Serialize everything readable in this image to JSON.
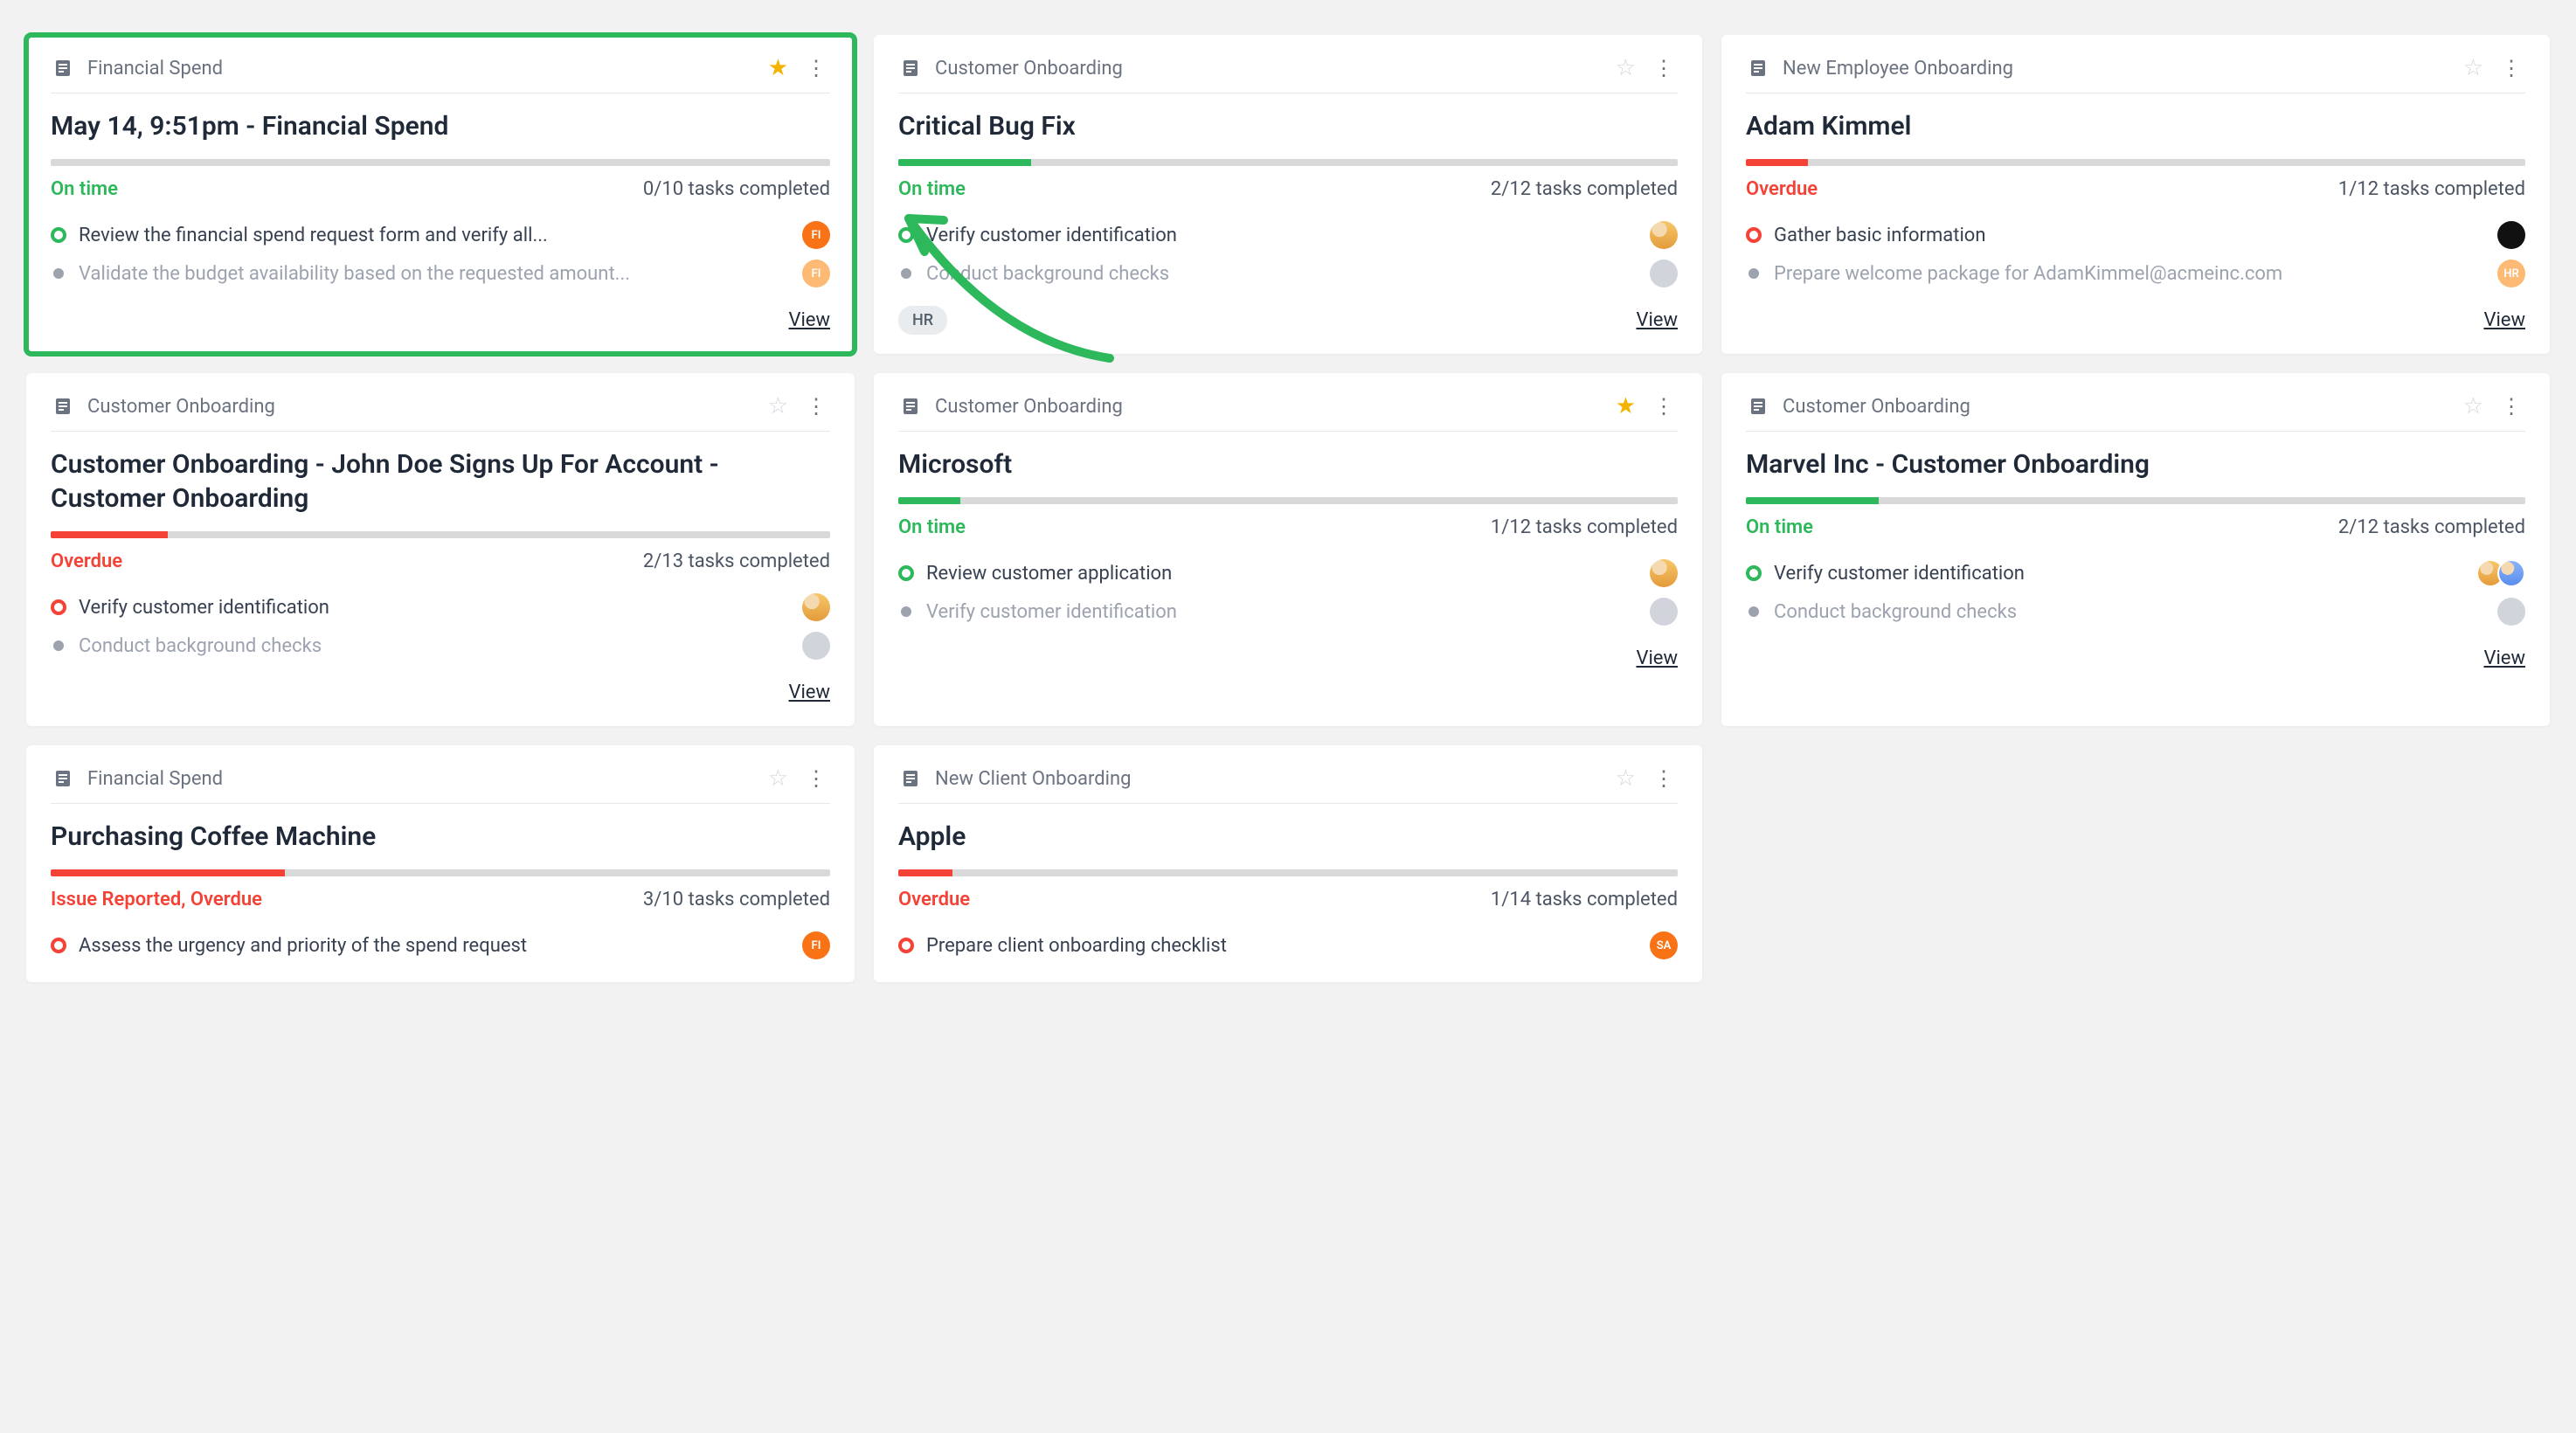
{
  "labels": {
    "view": "View"
  },
  "cards": [
    {
      "category": "Financial Spend",
      "starred": true,
      "title": "May 14, 9:51pm - Financial Spend",
      "progress_pct": 0,
      "progress_color": "green",
      "status_text": "On time",
      "status_color": "green",
      "tasks_text": "0/10 tasks completed",
      "tasks": [
        {
          "text": "Review the financial spend request form and verify all...",
          "state": "active",
          "avatar": {
            "type": "text",
            "label": "FI",
            "cls": "orange"
          }
        },
        {
          "text": "Validate the budget availability based on the requested amount...",
          "state": "pending",
          "muted": true,
          "avatar": {
            "type": "text",
            "label": "FI",
            "cls": "orange-muted"
          }
        }
      ],
      "tags": [],
      "highlight": true
    },
    {
      "category": "Customer Onboarding",
      "starred": false,
      "title": "Critical Bug Fix",
      "progress_pct": 17,
      "progress_color": "green",
      "status_text": "On time",
      "status_color": "green",
      "tasks_text": "2/12 tasks completed",
      "tasks": [
        {
          "text": "Verify customer identification",
          "state": "active",
          "avatar": {
            "type": "img",
            "cls": "img"
          }
        },
        {
          "text": "Conduct background checks",
          "state": "pending",
          "muted": true,
          "avatar": {
            "type": "img",
            "cls": "gray"
          }
        }
      ],
      "tags": [
        "HR"
      ]
    },
    {
      "category": "New Employee Onboarding",
      "starred": false,
      "title": "Adam Kimmel",
      "progress_pct": 8,
      "progress_color": "red",
      "status_text": "Overdue",
      "status_color": "red",
      "tasks_text": "1/12 tasks completed",
      "tasks": [
        {
          "text": "Gather basic information",
          "state": "active-red",
          "avatar": {
            "type": "img",
            "cls": "black"
          }
        },
        {
          "text": "Prepare welcome package for AdamKimmel@acmeinc.com",
          "state": "pending",
          "muted": true,
          "avatar": {
            "type": "text",
            "label": "HR",
            "cls": "orange-muted"
          }
        }
      ],
      "tags": []
    },
    {
      "category": "Customer Onboarding",
      "starred": false,
      "title": "Customer Onboarding - John Doe Signs Up For Account - Customer Onboarding",
      "progress_pct": 15,
      "progress_color": "red",
      "status_text": "Overdue",
      "status_color": "red",
      "tasks_text": "2/13 tasks completed",
      "tasks": [
        {
          "text": "Verify customer identification",
          "state": "active-red",
          "avatar": {
            "type": "img",
            "cls": "img"
          }
        },
        {
          "text": "Conduct background checks",
          "state": "pending",
          "muted": true,
          "avatar": {
            "type": "img",
            "cls": "gray"
          }
        }
      ],
      "tags": []
    },
    {
      "category": "Customer Onboarding",
      "starred": true,
      "title": "Microsoft",
      "progress_pct": 8,
      "progress_color": "green",
      "status_text": "On time",
      "status_color": "green",
      "tasks_text": "1/12 tasks completed",
      "tasks": [
        {
          "text": "Review customer application",
          "state": "active",
          "avatar": {
            "type": "img",
            "cls": "img"
          }
        },
        {
          "text": "Verify customer identification",
          "state": "pending",
          "muted": true,
          "avatar": {
            "type": "img",
            "cls": "gray"
          }
        }
      ],
      "tags": []
    },
    {
      "category": "Customer Onboarding",
      "starred": false,
      "title": "Marvel Inc - Customer Onboarding",
      "progress_pct": 17,
      "progress_color": "green",
      "status_text": "On time",
      "status_color": "green",
      "tasks_text": "2/12 tasks completed",
      "tasks": [
        {
          "text": "Verify customer identification",
          "state": "active",
          "avatar_stack": [
            {
              "cls": "img"
            },
            {
              "cls": "img2"
            }
          ]
        },
        {
          "text": "Conduct background checks",
          "state": "pending",
          "muted": true,
          "avatar": {
            "type": "img",
            "cls": "gray"
          }
        }
      ],
      "tags": []
    },
    {
      "category": "Financial Spend",
      "starred": false,
      "title": "Purchasing Coffee Machine",
      "progress_pct": 30,
      "progress_color": "red",
      "status_text": "Issue Reported, Overdue",
      "status_color": "red",
      "tasks_text": "3/10 tasks completed",
      "tasks": [
        {
          "text": "Assess the urgency and priority of the spend request",
          "state": "active-red",
          "avatar": {
            "type": "text",
            "label": "FI",
            "cls": "orange"
          }
        }
      ],
      "tags": [],
      "cutoff": true
    },
    {
      "category": "New Client Onboarding",
      "starred": false,
      "title": "Apple",
      "progress_pct": 7,
      "progress_color": "red",
      "status_text": "Overdue",
      "status_color": "red",
      "tasks_text": "1/14 tasks completed",
      "tasks": [
        {
          "text": "Prepare client onboarding checklist",
          "state": "active-red",
          "avatar": {
            "type": "text",
            "label": "SA",
            "cls": "orange"
          }
        }
      ],
      "tags": [],
      "cutoff": true
    }
  ]
}
